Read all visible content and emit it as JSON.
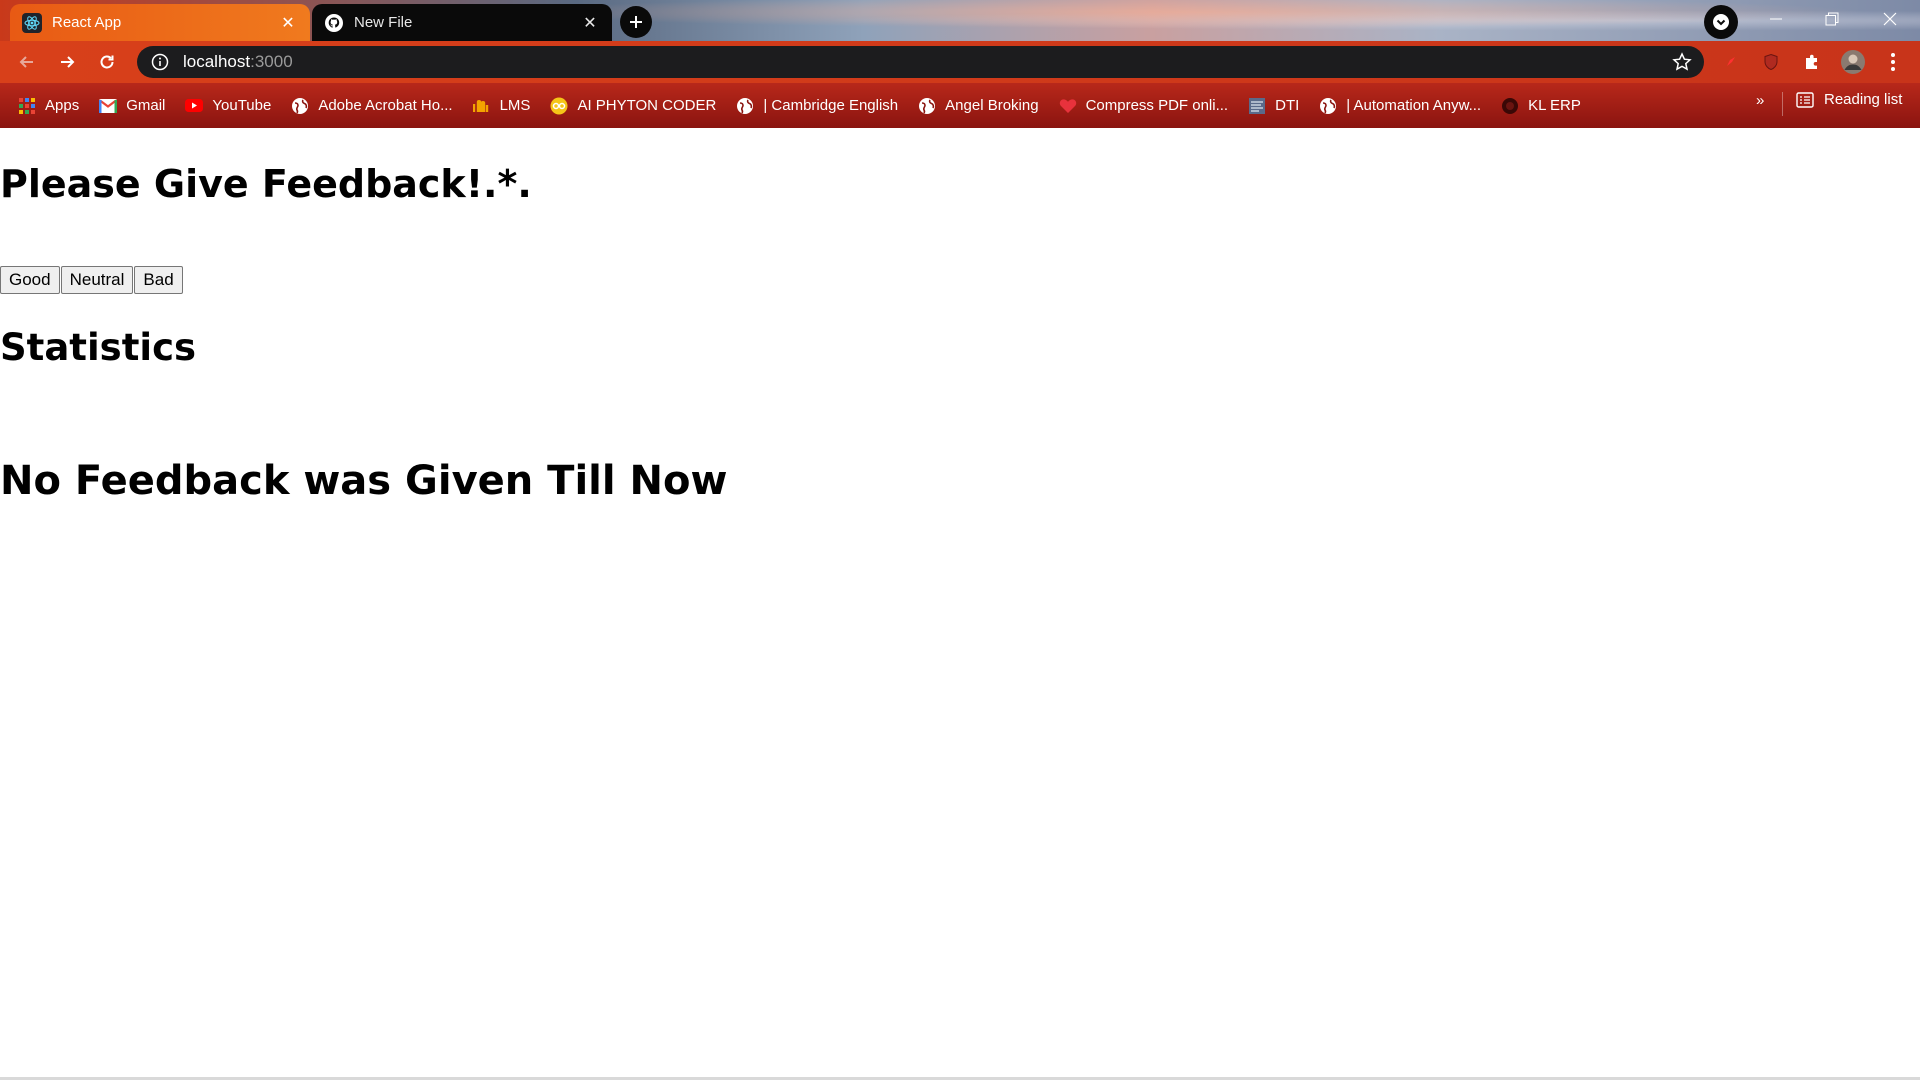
{
  "browser": {
    "tabs": [
      {
        "title": "React App",
        "icon": "react-icon",
        "active": true
      },
      {
        "title": "New File",
        "icon": "github-icon",
        "active": false
      }
    ],
    "close_glyph": "✕",
    "address": {
      "host": "localhost",
      "port": ":3000"
    },
    "bookmarks": [
      {
        "label": "Apps",
        "icon": "apps-grid-icon"
      },
      {
        "label": "Gmail",
        "icon": "gmail-icon"
      },
      {
        "label": "YouTube",
        "icon": "youtube-icon"
      },
      {
        "label": "Adobe Acrobat Ho...",
        "icon": "globe-icon"
      },
      {
        "label": "LMS",
        "icon": "lms-icon"
      },
      {
        "label": "AI PHYTON CODER",
        "icon": "coder-icon"
      },
      {
        "label": "| Cambridge English",
        "icon": "globe-icon"
      },
      {
        "label": "Angel Broking",
        "icon": "globe-icon"
      },
      {
        "label": "Compress PDF onli...",
        "icon": "heart-icon"
      },
      {
        "label": "DTI",
        "icon": "dti-icon"
      },
      {
        "label": "| Automation Anyw...",
        "icon": "globe-icon"
      },
      {
        "label": "KL ERP",
        "icon": "kl-erp-icon"
      }
    ],
    "more_glyph": "»",
    "reading_list": "Reading list"
  },
  "page": {
    "heading": "Please Give Feedback!.*.",
    "buttons": {
      "good": "Good",
      "neutral": "Neutral",
      "bad": "Bad"
    },
    "statistics_heading": "Statistics",
    "empty_message": "No Feedback was Given Till Now"
  }
}
